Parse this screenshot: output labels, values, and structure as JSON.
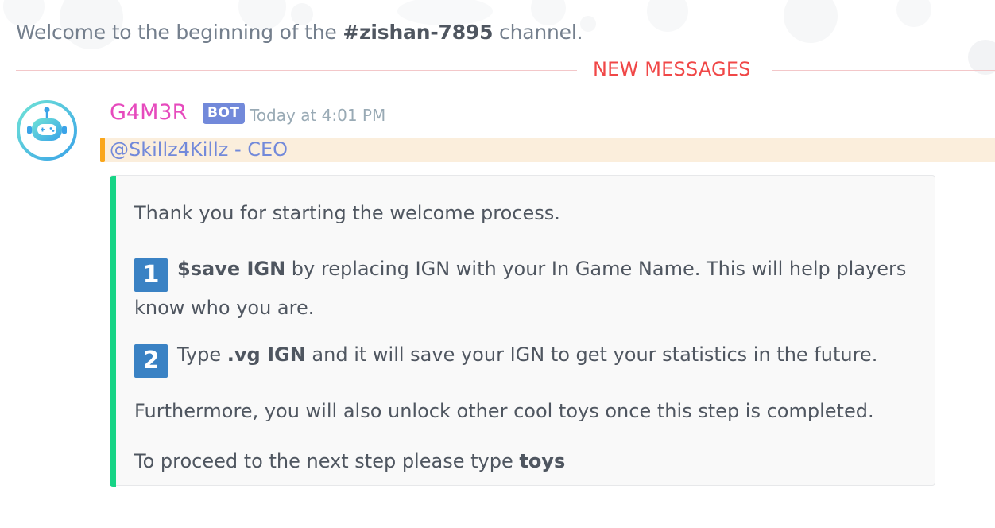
{
  "channel_header": {
    "welcome_prefix": "Welcome to the beginning of the ",
    "channel_name": "#zishan-7895",
    "welcome_suffix": " channel."
  },
  "divider": {
    "label": "NEW MESSAGES",
    "color": "#f04747"
  },
  "message": {
    "author": "G4M3R",
    "author_color": "#e64abd",
    "bot_tag": "BOT",
    "timestamp": "Today at 4:01 PM",
    "mention": "@Skillz4Killz - CEO",
    "avatar_icon": "robot-gamepad-icon",
    "embed": {
      "accent_color": "#17d486",
      "intro": "Thank you for starting the welcome process.",
      "step1": {
        "number": "1",
        "command": "$save IGN",
        "text_line1": " by replacing IGN with your In Game Name. This will help players",
        "text_line2": "know who you are."
      },
      "step2": {
        "number": "2",
        "prefix": "Type ",
        "command": ".vg IGN",
        "text": " and it will save your IGN to get your statistics in the future."
      },
      "furthermore": "Furthermore, you will also unlock other cool toys once this step is completed.",
      "proceed_prefix": "To proceed to the next step please type ",
      "proceed_command": "toys"
    }
  }
}
